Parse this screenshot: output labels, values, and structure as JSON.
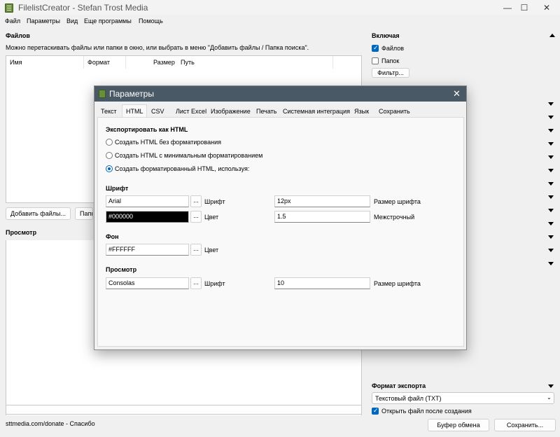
{
  "window": {
    "title": "FilelistCreator - Stefan Trost Media",
    "minimize": "—",
    "maximize": "☐",
    "close": "✕"
  },
  "menu": [
    "Файл",
    "Параметры",
    "Вид",
    "Еще программы",
    "Помощь"
  ],
  "files": {
    "title": "Файлов",
    "hint": "Можно перетаскивать файлы или папки в окно, или выбрать в меню \"Добавить файлы / Папка поиска\".",
    "columns": [
      "Имя",
      "Формат",
      "Размер",
      "Путь"
    ],
    "add_button": "Добавить файлы...",
    "folder_button": "Папк"
  },
  "preview": {
    "title": "Просмотр"
  },
  "include": {
    "title": "Включая",
    "files_label": "Файлов",
    "files_checked": true,
    "folders_label": "Папок",
    "folders_checked": false,
    "filter_button": "Фильтр..."
  },
  "export": {
    "title": "Формат экспорта",
    "format_value": "Текстовый файл (TXT)",
    "open_after_label": "Открыть файл после создания",
    "open_after_checked": true,
    "clipboard_button": "Буфер обмена",
    "save_button": "Сохранить..."
  },
  "status": {
    "text": "sttmedia.com/donate - Спасибо"
  },
  "dialog": {
    "title": "Параметры",
    "close": "✕",
    "tabs": [
      "Текст",
      "HTML",
      "CSV",
      "Лист Excel",
      "Изображение",
      "Печать",
      "Системная интеграция",
      "Язык",
      "Сохранить"
    ],
    "active_tab": "HTML",
    "export_as_title": "Экспортировать как HTML",
    "options": [
      "Создать HTML без форматирования",
      "Создать HTML с минимальным форматированием",
      "Создать форматированный HTML, используя:"
    ],
    "selected_option": 2,
    "font_section": {
      "title": "Шрифт",
      "font_value": "Arial",
      "font_label": "Шрифт",
      "size_value": "12px",
      "size_label": "Размер шрифта",
      "color_value": "#000000",
      "color_label": "Цвет",
      "line_value": "1.5",
      "line_label": "Межстрочный"
    },
    "bg_section": {
      "title": "Фон",
      "color_value": "#FFFFFF",
      "color_label": "Цвет"
    },
    "preview_section": {
      "title": "Просмотр",
      "font_value": "Consolas",
      "font_label": "Шрифт",
      "size_value": "10",
      "size_label": "Размер шрифта"
    },
    "dots": "..."
  },
  "colors": {
    "accent": "#0067c0",
    "dialog_titlebar": "#4a5966",
    "app_icon": "#6a8f3c"
  },
  "icons": [
    "app-icon",
    "minimize-icon",
    "maximize-icon",
    "close-icon",
    "dropdown-arrow-icon",
    "scroll-up-icon",
    "scroll-down-icon"
  ]
}
